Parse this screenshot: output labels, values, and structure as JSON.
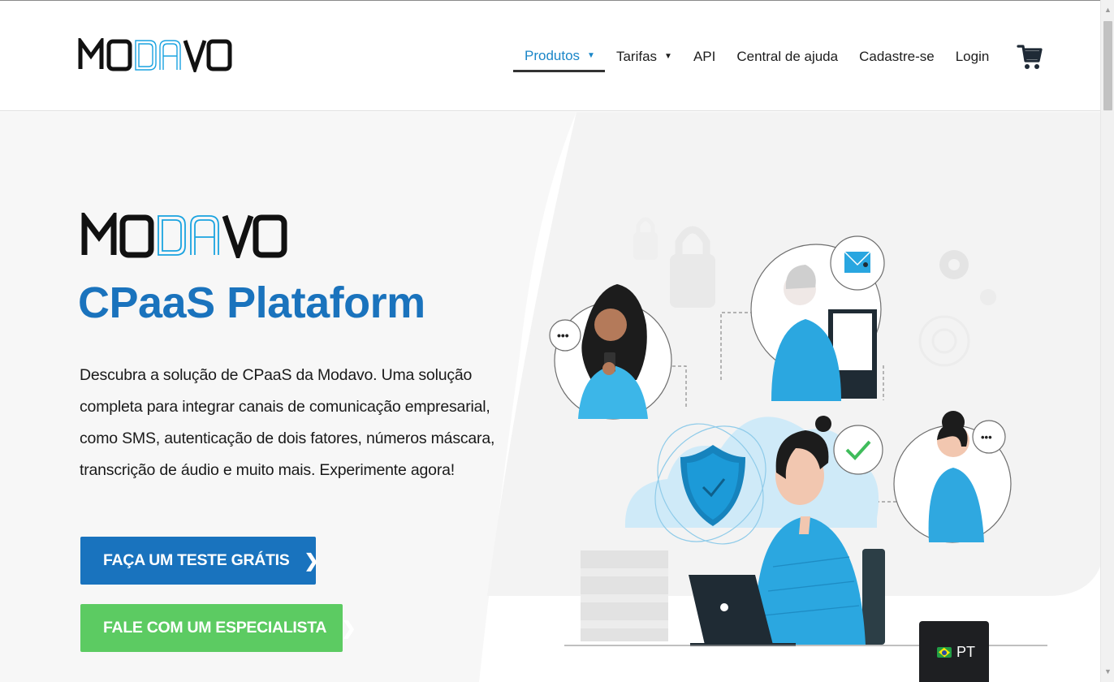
{
  "header": {
    "logo_text": "MODAVO",
    "nav": [
      {
        "label": "Produtos",
        "has_dropdown": true,
        "active": true
      },
      {
        "label": "Tarifas",
        "has_dropdown": true,
        "active": false
      },
      {
        "label": "API",
        "has_dropdown": false,
        "active": false
      },
      {
        "label": "Central de ajuda",
        "has_dropdown": false,
        "active": false
      },
      {
        "label": "Cadastre-se",
        "has_dropdown": false,
        "active": false
      },
      {
        "label": "Login",
        "has_dropdown": false,
        "active": false
      }
    ],
    "cart_icon": "shopping-cart-icon"
  },
  "hero": {
    "logo_text": "MODAVO",
    "title": "CPaaS Plataform",
    "description": "Descubra a solução de CPaaS da Modavo. Uma solução completa para integrar canais de comunicação empresarial, como SMS, autenticação de dois fatores, números máscara, transcrição de áudio e muito mais. Experimente agora!",
    "primary_button": "FAÇA UM TESTE GRÁTIS",
    "secondary_button": "FALE COM UM ESPECIALISTA",
    "button_chevron": "❯"
  },
  "language": {
    "label": "PT",
    "flag": "brazil-flag-icon"
  },
  "colors": {
    "brand_blue": "#1a73bd",
    "nav_active": "#1a86c8",
    "cta_blue": "#1973be",
    "cta_green": "#5ccb62",
    "illustration_blue": "#29a6e0"
  }
}
